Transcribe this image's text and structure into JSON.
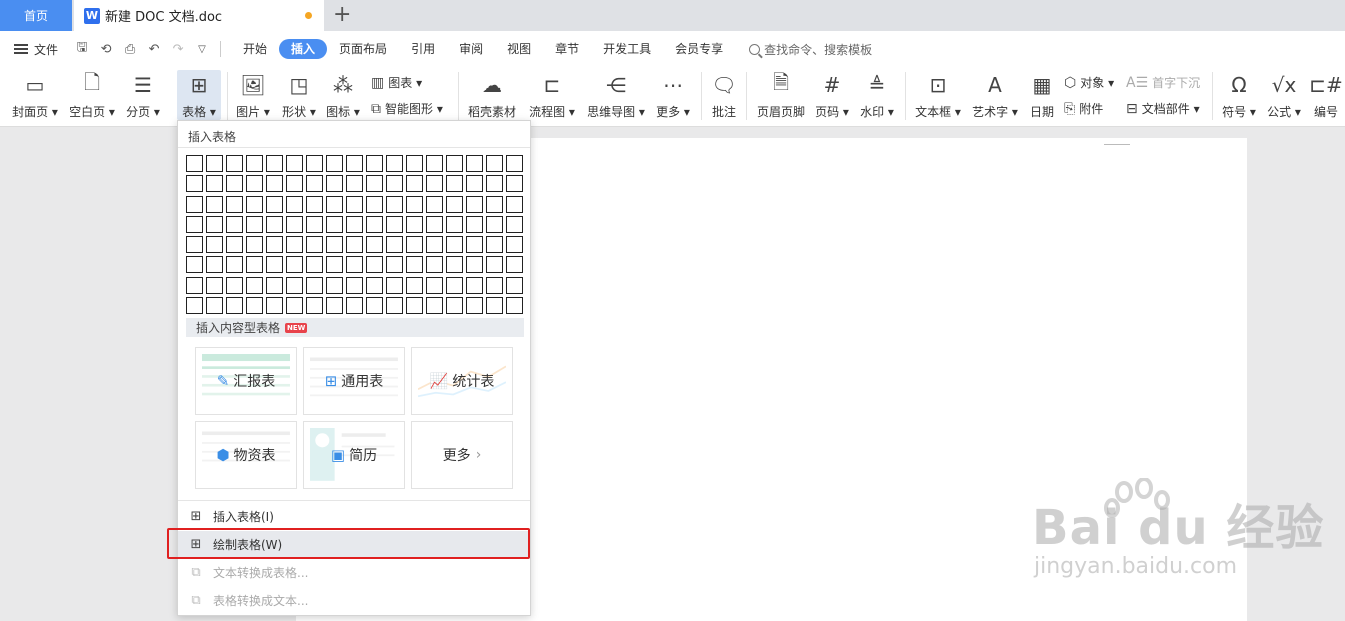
{
  "titlebar": {
    "home_tab": "首页",
    "doc_tab": "新建 DOC 文档.doc",
    "doc_icon_letter": "W",
    "new_tab": "+"
  },
  "menubar": {
    "file": "文件",
    "quick_access": [
      "save-icon",
      "format-painter-icon",
      "print-icon",
      "undo-icon",
      "redo-icon",
      "customize-icon"
    ],
    "tabs": [
      "开始",
      "插入",
      "页面布局",
      "引用",
      "审阅",
      "视图",
      "章节",
      "开发工具",
      "会员专享"
    ],
    "active_tab": "插入",
    "search_placeholder": "查找命令、搜索模板"
  },
  "ribbon": {
    "cover": "封面页",
    "blank_page": "空白页",
    "page_break": "分页",
    "table": "表格",
    "picture": "图片",
    "shape": "形状",
    "icon": "图标",
    "chart": "图表",
    "smart_art": "智能图形",
    "docer_material": "稻壳素材",
    "flowchart": "流程图",
    "mind_map": "思维导图",
    "more": "更多",
    "comment": "批注",
    "header_footer": "页眉页脚",
    "page_number": "页码",
    "watermark": "水印",
    "text_box": "文本框",
    "word_art": "艺术字",
    "date": "日期",
    "object": "对象",
    "attachment": "附件",
    "drop_cap": "首字下沉",
    "doc_parts": "文档部件",
    "symbol": "符号",
    "formula": "公式",
    "numbering": "编号"
  },
  "dropdown": {
    "title": "插入表格",
    "grid_cols": 17,
    "grid_rows": 8,
    "section_title": "插入内容型表格",
    "new_badge": "NEW",
    "cards": [
      {
        "label": "汇报表",
        "icon": "edit-icon"
      },
      {
        "label": "通用表",
        "icon": "grid-icon"
      },
      {
        "label": "统计表",
        "icon": "trend-chart-icon"
      },
      {
        "label": "物资表",
        "icon": "box-icon"
      },
      {
        "label": "简历",
        "icon": "resume-icon"
      },
      {
        "label": "更多",
        "icon": "chevron-right-icon"
      }
    ],
    "menu": [
      {
        "label": "插入表格(I)",
        "enabled": true
      },
      {
        "label": "绘制表格(W)",
        "enabled": true,
        "highlighted": true
      },
      {
        "label": "文本转换成表格...",
        "enabled": false
      },
      {
        "label": "表格转换成文本...",
        "enabled": false
      }
    ]
  },
  "watermark": {
    "main": "Bai du 经验",
    "sub": "jingyan.baidu.com"
  },
  "colors": {
    "accent": "#4a8ef1",
    "highlight_box": "#e02020",
    "unsaved_dot": "#f5a623"
  }
}
